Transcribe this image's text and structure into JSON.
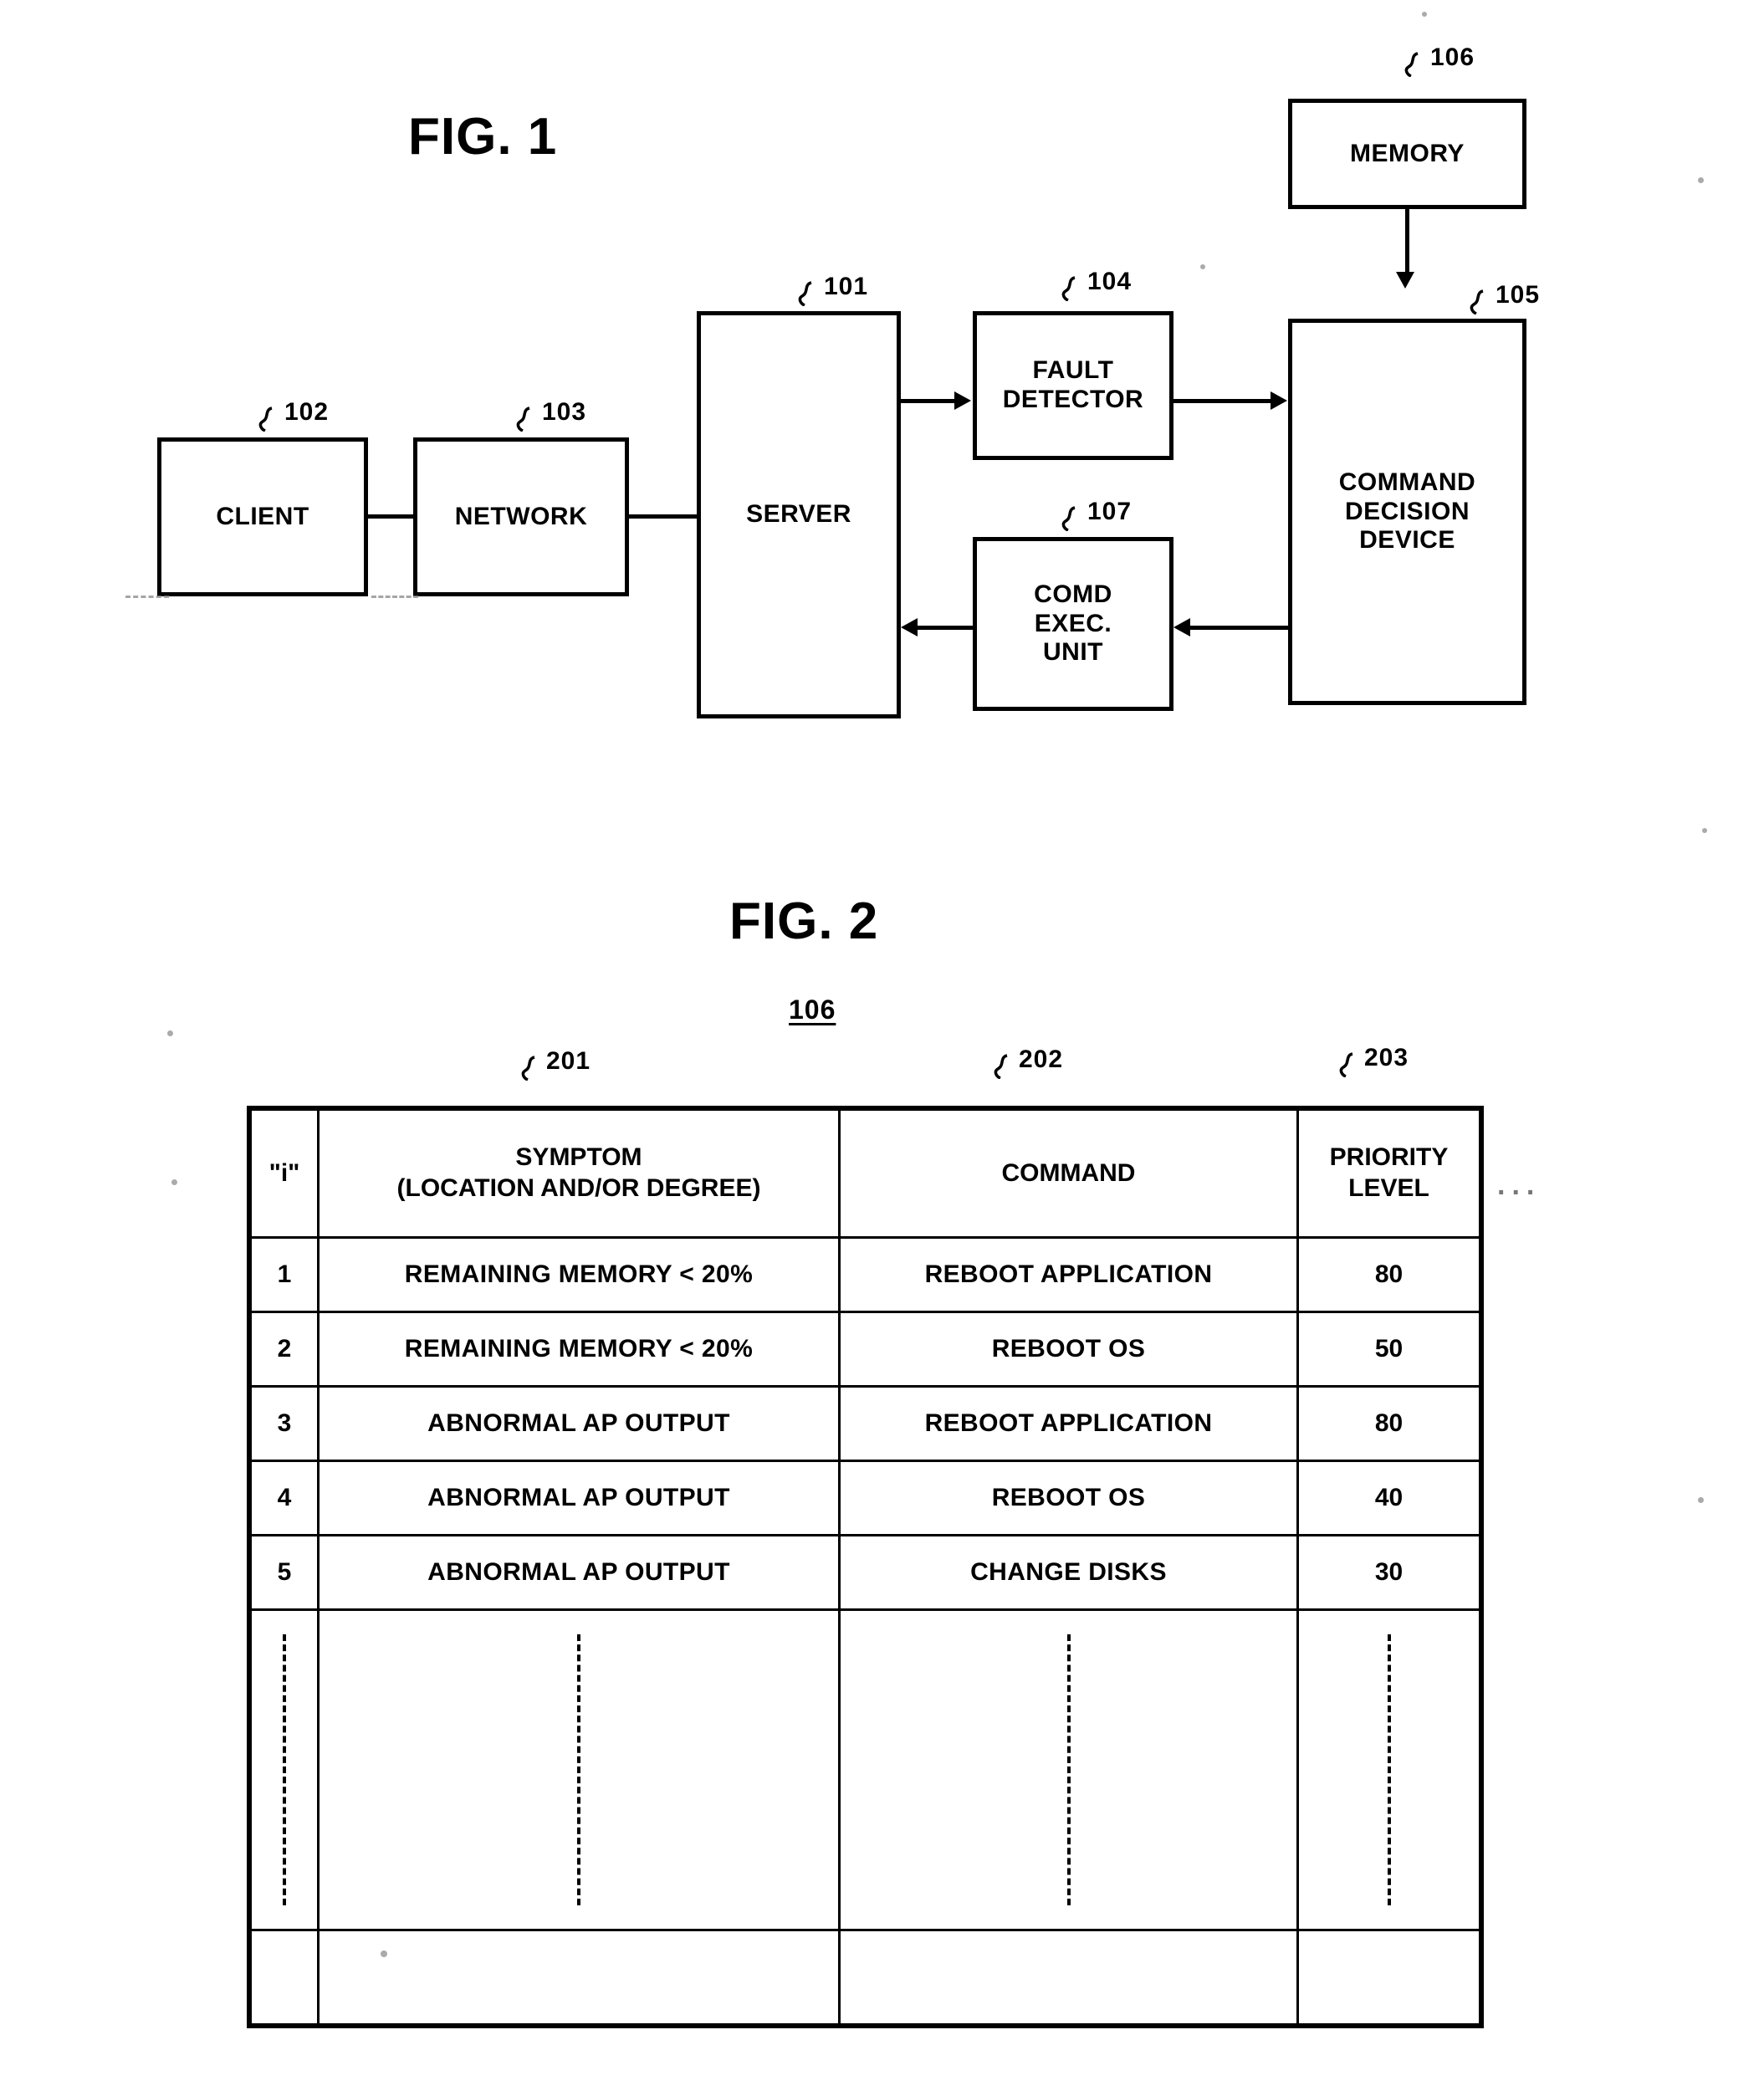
{
  "page": {
    "figures": [
      {
        "id": "fig1",
        "title": "FIG. 1"
      },
      {
        "id": "fig2",
        "title": "FIG. 2"
      }
    ]
  },
  "fig1": {
    "title": "FIG. 1",
    "blocks": [
      {
        "key": "client",
        "label": "CLIENT",
        "ref": "102"
      },
      {
        "key": "network",
        "label": "NETWORK",
        "ref": "103"
      },
      {
        "key": "server",
        "label": "SERVER",
        "ref": "101"
      },
      {
        "key": "fault",
        "label": "FAULT\nDETECTOR",
        "ref": "104"
      },
      {
        "key": "comdexec",
        "label": "COMD\nEXEC.\nUNIT",
        "ref": "107"
      },
      {
        "key": "memory",
        "label": "MEMORY",
        "ref": "106"
      },
      {
        "key": "command",
        "label": "COMMAND\nDECISION\nDEVICE",
        "ref": "105"
      }
    ],
    "labels": {
      "client": "CLIENT",
      "network": "NETWORK",
      "server": "SERVER",
      "fault_line1": "FAULT",
      "fault_line2": "DETECTOR",
      "comdexec_line1": "COMD",
      "comdexec_line2": "EXEC.",
      "comdexec_line3": "UNIT",
      "memory": "MEMORY",
      "command_line1": "COMMAND",
      "command_line2": "DECISION",
      "command_line3": "DEVICE"
    },
    "refs": {
      "client": "102",
      "network": "103",
      "server": "101",
      "fault": "104",
      "comdexec": "107",
      "memory": "106",
      "command": "105"
    },
    "connections": [
      {
        "from": "client",
        "to": "network",
        "type": "line",
        "direction": "none"
      },
      {
        "from": "network",
        "to": "server",
        "type": "line",
        "direction": "none"
      },
      {
        "from": "server",
        "to": "fault",
        "type": "arrow",
        "direction": "right"
      },
      {
        "from": "fault",
        "to": "command",
        "type": "arrow",
        "direction": "right"
      },
      {
        "from": "memory",
        "to": "command",
        "type": "arrow",
        "direction": "down"
      },
      {
        "from": "command",
        "to": "comdexec",
        "type": "arrow",
        "direction": "left"
      },
      {
        "from": "comdexec",
        "to": "server",
        "type": "arrow",
        "direction": "left"
      }
    ]
  },
  "fig2": {
    "title": "FIG. 2",
    "table_ref": "106",
    "column_refs": {
      "symptom": "201",
      "command": "202",
      "priority": "203"
    },
    "headers": {
      "index": "\"i\"",
      "symptom_line1": "SYMPTOM",
      "symptom_line2": "(LOCATION AND/OR DEGREE)",
      "command": "COMMAND",
      "priority_line1": "PRIORITY",
      "priority_line2": "LEVEL"
    },
    "rows": [
      {
        "i": "1",
        "symptom": "REMAINING MEMORY < 20%",
        "command": "REBOOT APPLICATION",
        "priority": "80"
      },
      {
        "i": "2",
        "symptom": "REMAINING MEMORY < 20%",
        "command": "REBOOT OS",
        "priority": "50"
      },
      {
        "i": "3",
        "symptom": "ABNORMAL AP OUTPUT",
        "command": "REBOOT APPLICATION",
        "priority": "80"
      },
      {
        "i": "4",
        "symptom": "ABNORMAL AP OUTPUT",
        "command": "REBOOT OS",
        "priority": "40"
      },
      {
        "i": "5",
        "symptom": "ABNORMAL AP OUTPUT",
        "command": "CHANGE DISKS",
        "priority": "30"
      }
    ],
    "continuation_marker": "vertical-dashed-ellipsis",
    "trailing_dots": "..."
  },
  "colors": {
    "ink": "#000000",
    "paper": "#ffffff",
    "artifact": "#999999"
  }
}
